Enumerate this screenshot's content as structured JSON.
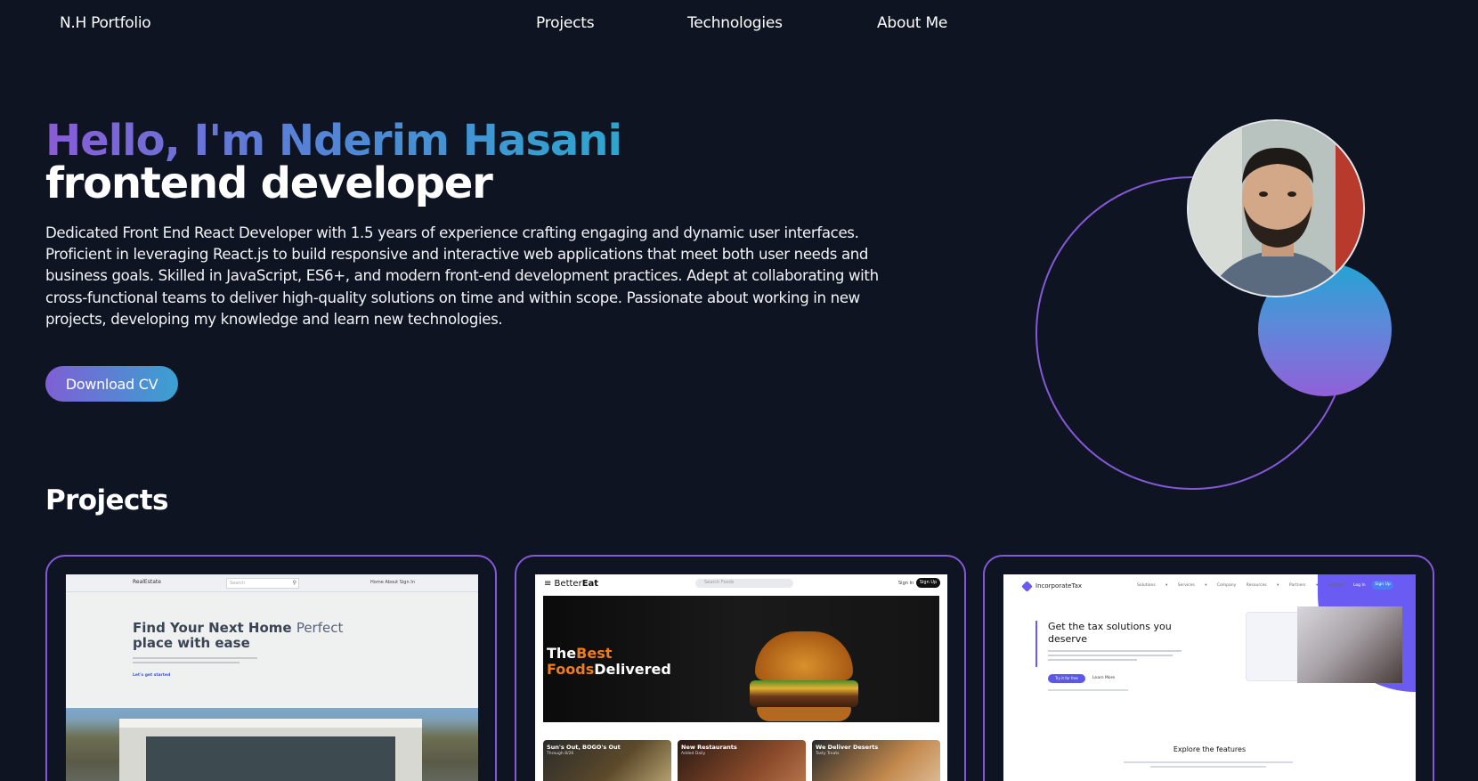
{
  "nav": {
    "brand": "N.H Portfolio",
    "links": [
      "Projects",
      "Technologies",
      "About Me"
    ]
  },
  "hero": {
    "greeting": "Hello, I'm Nderim Hasani",
    "role": "frontend developer",
    "bio": "Dedicated Front End React Developer with 1.5 years of experience crafting engaging and dynamic user interfaces. Proficient in leveraging React.js to build responsive and interactive web applications that meet both user needs and business goals. Skilled in JavaScript, ES6+, and modern front-end development practices. Adept at collaborating with cross-functional teams to deliver high-quality solutions on time and within scope. Passionate about working in new projects, developing my knowledge and learn new technologies.",
    "cv_button": "Download CV"
  },
  "colors": {
    "background": "#0f1422",
    "accent_purple": "#8459d8",
    "accent_blue": "#2da6cf"
  },
  "projects": {
    "title": "Projects",
    "cards": [
      {
        "name": "RealEstate",
        "search_placeholder": "Search",
        "nav": "Home  About  Sign In",
        "headline_1": "Find Your Next Home",
        "headline_accent": "Perfect",
        "headline_2": "place with ease",
        "cta": "Let's get started"
      },
      {
        "logo_prefix": "≡ Better",
        "logo_bold": "Eat",
        "search_placeholder": "Search Foods",
        "signin": "Sign In",
        "signup": "Sign Up",
        "headline_a": "The",
        "headline_b": "Best",
        "headline_c": "Foods",
        "headline_d": "Delivered",
        "tiles": [
          {
            "title": "Sun's Out, BOGO's Out",
            "sub": "Through 8/26"
          },
          {
            "title": "New Restaurants",
            "sub": "Added Daily"
          },
          {
            "title": "We Deliver Deserts",
            "sub": "Tasty Treats"
          }
        ]
      },
      {
        "logo": "IncorporateTax",
        "menu": "Solutions ▾  Services ▾  Company  Resources ▾  Partners ▾  Support",
        "login": "Log In",
        "signup": "Sign Up",
        "headline": "Get the tax solutions you deserve",
        "cta_primary": "Try it for free",
        "cta_secondary": "Learn More",
        "explore": "Explore the features"
      }
    ]
  }
}
